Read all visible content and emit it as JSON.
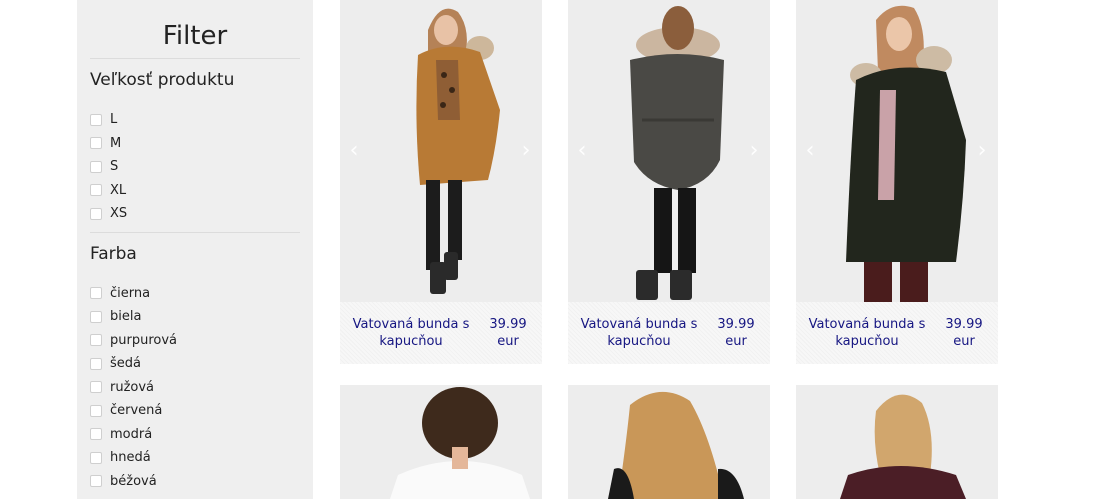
{
  "filter": {
    "title": "Filter",
    "size_section": {
      "title": "Veľkosť produktu",
      "options": [
        "L",
        "M",
        "S",
        "XL",
        "XS"
      ]
    },
    "color_section": {
      "title": "Farba",
      "options": [
        "čierna",
        "biela",
        "purpurová",
        "šedá",
        "ružová",
        "červená",
        "modrá",
        "hnedá",
        "béžová"
      ]
    }
  },
  "products": [
    {
      "name": "Vatovaná bunda s kapucňou",
      "price": "39.99",
      "currency": "eur",
      "image": "model-in-camel-parka-front"
    },
    {
      "name": "Vatovaná bunda s kapucňou",
      "price": "39.99",
      "currency": "eur",
      "image": "model-in-grey-parka-back"
    },
    {
      "name": "Vatovaná bunda s kapucňou",
      "price": "39.99",
      "currency": "eur",
      "image": "model-in-black-parka-front"
    },
    {
      "image": "model-white-top-back"
    },
    {
      "image": "model-black-top-back"
    },
    {
      "image": "model-burgundy-top-back"
    }
  ],
  "icons": {
    "prev": "chevron-left-icon",
    "next": "chevron-right-icon"
  }
}
